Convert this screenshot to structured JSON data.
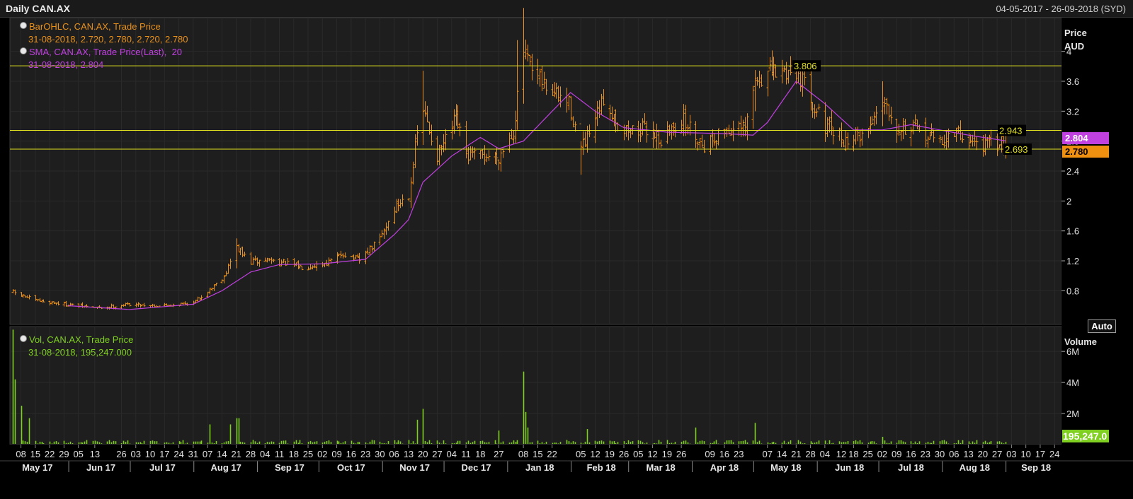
{
  "header": {
    "title": "Daily CAN.AX",
    "date_range": "04-05-2017 - 26-09-2018 (SYD)"
  },
  "legend": {
    "bar_name": "BarOHLC, CAN.AX, Trade Price",
    "bar_values": "31-08-2018, 2.720, 2.780, 2.720, 2.780",
    "sma_name": "SMA, CAN.AX, Trade Price(Last),",
    "sma_period": "20",
    "sma_values": "31-08-2018, 2.804",
    "vol_name": "Vol, CAN.AX, Trade Price",
    "vol_values": "31-08-2018, 195,247.000"
  },
  "auto_button": "Auto",
  "colors": {
    "ohlc": "#e8901c",
    "sma": "#c040e0",
    "volume": "#7fd020",
    "hline": "#e0e020",
    "grid": "#2a2a2a",
    "background": "#000000"
  },
  "chart_data": [
    {
      "type": "ohlc",
      "price_axis": {
        "label_line1": "Price",
        "label_line2": "AUD",
        "ticks": [
          0.8,
          1.2,
          1.6,
          2,
          2.4,
          2.8,
          3.2,
          3.6,
          4
        ],
        "tick_labels": [
          "0.8",
          "1.2",
          "1.6",
          "2",
          "2.4",
          "2.8",
          "3.2",
          "3.6",
          "4"
        ],
        "ylim": [
          0.35,
          4.45
        ]
      },
      "hlines": [
        {
          "value": 3.806,
          "label": "3.806"
        },
        {
          "value": 2.943,
          "label": "2.943"
        },
        {
          "value": 2.693,
          "label": "2.693"
        }
      ],
      "last_price_markers": [
        {
          "value": 2.804,
          "label": "2.804",
          "color": "#c040e0"
        },
        {
          "value": 2.78,
          "label": "2.780",
          "color": "#f09010"
        }
      ],
      "close_anchors": [
        [
          "2017-05-04",
          0.78
        ],
        [
          "2017-05-15",
          0.67
        ],
        [
          "2017-05-29",
          0.62
        ],
        [
          "2017-06-15",
          0.57
        ],
        [
          "2017-06-30",
          0.62
        ],
        [
          "2017-07-15",
          0.6
        ],
        [
          "2017-07-31",
          0.64
        ],
        [
          "2017-08-08",
          0.82
        ],
        [
          "2017-08-15",
          1.0
        ],
        [
          "2017-08-21",
          1.38
        ],
        [
          "2017-08-28",
          1.18
        ],
        [
          "2017-09-05",
          1.22
        ],
        [
          "2017-09-22",
          1.12
        ],
        [
          "2017-10-05",
          1.18
        ],
        [
          "2017-10-12",
          1.3
        ],
        [
          "2017-10-20",
          1.2
        ],
        [
          "2017-10-30",
          1.5
        ],
        [
          "2017-11-06",
          1.9
        ],
        [
          "2017-11-13",
          2.1
        ],
        [
          "2017-11-17",
          2.9
        ],
        [
          "2017-11-20",
          3.2
        ],
        [
          "2017-11-27",
          2.6
        ],
        [
          "2017-12-01",
          2.8
        ],
        [
          "2017-12-06",
          3.1
        ],
        [
          "2017-12-11",
          2.6
        ],
        [
          "2017-12-27",
          2.6
        ],
        [
          "2018-01-03",
          2.95
        ],
        [
          "2018-01-08",
          4.0
        ],
        [
          "2018-01-12",
          3.7
        ],
        [
          "2018-01-22",
          3.45
        ],
        [
          "2018-01-30",
          3.3
        ],
        [
          "2018-02-05",
          2.7
        ],
        [
          "2018-02-08",
          2.8
        ],
        [
          "2018-02-16",
          3.35
        ],
        [
          "2018-02-26",
          2.95
        ],
        [
          "2018-03-12",
          2.95
        ],
        [
          "2018-03-16",
          2.8
        ],
        [
          "2018-03-26",
          3.1
        ],
        [
          "2018-04-06",
          2.75
        ],
        [
          "2018-04-16",
          2.95
        ],
        [
          "2018-04-26",
          2.95
        ],
        [
          "2018-05-01",
          3.6
        ],
        [
          "2018-05-07",
          3.7
        ],
        [
          "2018-05-21",
          3.75
        ],
        [
          "2018-05-28",
          3.4
        ],
        [
          "2018-06-04",
          3.0
        ],
        [
          "2018-06-14",
          2.8
        ],
        [
          "2018-06-25",
          2.95
        ],
        [
          "2018-07-02",
          3.4
        ],
        [
          "2018-07-09",
          3.0
        ],
        [
          "2018-07-23",
          2.9
        ],
        [
          "2018-07-30",
          2.8
        ],
        [
          "2018-08-06",
          2.9
        ],
        [
          "2018-08-13",
          2.8
        ],
        [
          "2018-08-23",
          2.75
        ],
        [
          "2018-08-31",
          2.78
        ]
      ],
      "sma_anchors": [
        [
          "2017-05-31",
          0.6
        ],
        [
          "2017-06-30",
          0.55
        ],
        [
          "2017-07-31",
          0.62
        ],
        [
          "2017-08-14",
          0.8
        ],
        [
          "2017-08-28",
          1.05
        ],
        [
          "2017-09-11",
          1.15
        ],
        [
          "2017-10-02",
          1.16
        ],
        [
          "2017-10-23",
          1.22
        ],
        [
          "2017-11-06",
          1.55
        ],
        [
          "2017-11-13",
          1.75
        ],
        [
          "2017-11-20",
          2.25
        ],
        [
          "2017-12-04",
          2.6
        ],
        [
          "2017-12-18",
          2.85
        ],
        [
          "2017-12-27",
          2.7
        ],
        [
          "2018-01-08",
          2.8
        ],
        [
          "2018-01-22",
          3.2
        ],
        [
          "2018-01-31",
          3.45
        ],
        [
          "2018-02-12",
          3.2
        ],
        [
          "2018-02-26",
          2.98
        ],
        [
          "2018-03-19",
          2.92
        ],
        [
          "2018-04-16",
          2.9
        ],
        [
          "2018-04-30",
          2.88
        ],
        [
          "2018-05-07",
          3.05
        ],
        [
          "2018-05-21",
          3.6
        ],
        [
          "2018-06-04",
          3.3
        ],
        [
          "2018-06-18",
          2.95
        ],
        [
          "2018-07-02",
          2.95
        ],
        [
          "2018-07-16",
          3.02
        ],
        [
          "2018-07-30",
          2.95
        ],
        [
          "2018-08-13",
          2.88
        ],
        [
          "2018-08-31",
          2.804
        ]
      ],
      "spikes": [
        {
          "date": "2018-01-08",
          "high": 4.58,
          "low": 3.3
        },
        {
          "date": "2018-01-05",
          "high": 4.15,
          "low": 2.95
        },
        {
          "date": "2017-11-20",
          "high": 3.74,
          "low": 2.75
        },
        {
          "date": "2018-02-05",
          "high": 2.8,
          "low": 2.35
        },
        {
          "date": "2018-05-01",
          "high": 3.75,
          "low": 3.2
        },
        {
          "date": "2018-07-02",
          "high": 3.6,
          "low": 3.0
        },
        {
          "date": "2017-08-21",
          "high": 1.5,
          "low": 1.1
        }
      ]
    },
    {
      "type": "bar",
      "volume_axis": {
        "label": "Volume",
        "ticks": [
          2000000,
          4000000,
          6000000
        ],
        "tick_labels": [
          "2M",
          "4M",
          "6M"
        ],
        "ylim": [
          0,
          7600000
        ]
      },
      "last_volume_marker": {
        "value": 195247,
        "label": "195,247.0"
      },
      "volume_base": 150000,
      "spikes": [
        {
          "date": "2017-05-04",
          "value": 7400000
        },
        {
          "date": "2017-05-05",
          "value": 4200000
        },
        {
          "date": "2017-05-08",
          "value": 2500000
        },
        {
          "date": "2017-05-12",
          "value": 1700000
        },
        {
          "date": "2017-11-20",
          "value": 2300000
        },
        {
          "date": "2017-11-17",
          "value": 1600000
        },
        {
          "date": "2018-01-08",
          "value": 4700000
        },
        {
          "date": "2018-01-09",
          "value": 2100000
        },
        {
          "date": "2018-01-10",
          "value": 1100000
        },
        {
          "date": "2017-08-21",
          "value": 1700000
        },
        {
          "date": "2017-08-22",
          "value": 1700000
        },
        {
          "date": "2017-08-18",
          "value": 1300000
        },
        {
          "date": "2017-08-08",
          "value": 1300000
        },
        {
          "date": "2018-05-01",
          "value": 1400000
        },
        {
          "date": "2018-04-02",
          "value": 1100000
        },
        {
          "date": "2018-02-08",
          "value": 1000000
        },
        {
          "date": "2017-12-27",
          "value": 900000
        },
        {
          "date": "2018-07-02",
          "value": 500000
        }
      ]
    }
  ],
  "x_axis": {
    "day_ticks": [
      {
        "date": "2017-05-08",
        "label": "08"
      },
      {
        "date": "2017-05-15",
        "label": "15"
      },
      {
        "date": "2017-05-22",
        "label": "22"
      },
      {
        "date": "2017-05-29",
        "label": "29"
      },
      {
        "date": "2017-06-05",
        "label": "05"
      },
      {
        "date": "2017-06-13",
        "label": "13"
      },
      {
        "date": "2017-06-26",
        "label": "26"
      },
      {
        "date": "2017-07-03",
        "label": "03"
      },
      {
        "date": "2017-07-10",
        "label": "10"
      },
      {
        "date": "2017-07-17",
        "label": "17"
      },
      {
        "date": "2017-07-24",
        "label": "24"
      },
      {
        "date": "2017-07-31",
        "label": "31"
      },
      {
        "date": "2017-08-07",
        "label": "07"
      },
      {
        "date": "2017-08-14",
        "label": "14"
      },
      {
        "date": "2017-08-21",
        "label": "21"
      },
      {
        "date": "2017-08-28",
        "label": "28"
      },
      {
        "date": "2017-09-04",
        "label": "04"
      },
      {
        "date": "2017-09-11",
        "label": "11"
      },
      {
        "date": "2017-09-18",
        "label": "18"
      },
      {
        "date": "2017-09-25",
        "label": "25"
      },
      {
        "date": "2017-10-02",
        "label": "02"
      },
      {
        "date": "2017-10-09",
        "label": "09"
      },
      {
        "date": "2017-10-16",
        "label": "16"
      },
      {
        "date": "2017-10-23",
        "label": "23"
      },
      {
        "date": "2017-10-30",
        "label": "30"
      },
      {
        "date": "2017-11-06",
        "label": "06"
      },
      {
        "date": "2017-11-13",
        "label": "13"
      },
      {
        "date": "2017-11-20",
        "label": "20"
      },
      {
        "date": "2017-11-27",
        "label": "27"
      },
      {
        "date": "2017-12-04",
        "label": "04"
      },
      {
        "date": "2017-12-11",
        "label": "11"
      },
      {
        "date": "2017-12-18",
        "label": "18"
      },
      {
        "date": "2017-12-27",
        "label": "27"
      },
      {
        "date": "2018-01-08",
        "label": "08"
      },
      {
        "date": "2018-01-15",
        "label": "15"
      },
      {
        "date": "2018-01-22",
        "label": "22"
      },
      {
        "date": "2018-02-05",
        "label": "05"
      },
      {
        "date": "2018-02-12",
        "label": "12"
      },
      {
        "date": "2018-02-19",
        "label": "19"
      },
      {
        "date": "2018-02-26",
        "label": "26"
      },
      {
        "date": "2018-03-05",
        "label": "05"
      },
      {
        "date": "2018-03-12",
        "label": "12"
      },
      {
        "date": "2018-03-19",
        "label": "19"
      },
      {
        "date": "2018-03-26",
        "label": "26"
      },
      {
        "date": "2018-04-09",
        "label": "09"
      },
      {
        "date": "2018-04-16",
        "label": "16"
      },
      {
        "date": "2018-04-23",
        "label": "23"
      },
      {
        "date": "2018-05-07",
        "label": "07"
      },
      {
        "date": "2018-05-14",
        "label": "14"
      },
      {
        "date": "2018-05-21",
        "label": "21"
      },
      {
        "date": "2018-05-28",
        "label": "28"
      },
      {
        "date": "2018-06-04",
        "label": "04"
      },
      {
        "date": "2018-06-12",
        "label": "12"
      },
      {
        "date": "2018-06-18",
        "label": "18"
      },
      {
        "date": "2018-06-25",
        "label": "25"
      },
      {
        "date": "2018-07-02",
        "label": "02"
      },
      {
        "date": "2018-07-09",
        "label": "09"
      },
      {
        "date": "2018-07-16",
        "label": "16"
      },
      {
        "date": "2018-07-23",
        "label": "23"
      },
      {
        "date": "2018-07-30",
        "label": "30"
      },
      {
        "date": "2018-08-06",
        "label": "06"
      },
      {
        "date": "2018-08-13",
        "label": "13"
      },
      {
        "date": "2018-08-20",
        "label": "20"
      },
      {
        "date": "2018-08-27",
        "label": "27"
      },
      {
        "date": "2018-09-03",
        "label": "03"
      },
      {
        "date": "2018-09-10",
        "label": "10"
      },
      {
        "date": "2018-09-17",
        "label": "17"
      },
      {
        "date": "2018-09-24",
        "label": "24"
      }
    ],
    "month_ticks": [
      {
        "date": "2017-05-16",
        "label": "May 17"
      },
      {
        "date": "2017-06-16",
        "label": "Jun 17"
      },
      {
        "date": "2017-07-16",
        "label": "Jul 17"
      },
      {
        "date": "2017-08-16",
        "label": "Aug 17"
      },
      {
        "date": "2017-09-16",
        "label": "Sep 17"
      },
      {
        "date": "2017-10-16",
        "label": "Oct 17"
      },
      {
        "date": "2017-11-16",
        "label": "Nov 17"
      },
      {
        "date": "2017-12-16",
        "label": "Dec 17"
      },
      {
        "date": "2018-01-16",
        "label": "Jan 18"
      },
      {
        "date": "2018-02-15",
        "label": "Feb 18"
      },
      {
        "date": "2018-03-16",
        "label": "Mar 18"
      },
      {
        "date": "2018-04-16",
        "label": "Apr 18"
      },
      {
        "date": "2018-05-16",
        "label": "May 18"
      },
      {
        "date": "2018-06-16",
        "label": "Jun 18"
      },
      {
        "date": "2018-07-16",
        "label": "Jul 18"
      },
      {
        "date": "2018-08-16",
        "label": "Aug 18"
      },
      {
        "date": "2018-09-15",
        "label": "Sep 18"
      }
    ],
    "month_separators": [
      "2017-06-01",
      "2017-07-01",
      "2017-08-01",
      "2017-09-01",
      "2017-10-01",
      "2017-11-01",
      "2017-12-01",
      "2018-01-01",
      "2018-02-01",
      "2018-03-01",
      "2018-04-01",
      "2018-05-01",
      "2018-06-01",
      "2018-07-01",
      "2018-08-01",
      "2018-09-01"
    ],
    "start_date": "2017-05-04",
    "end_date": "2018-09-26",
    "last_data_date": "2018-08-31"
  }
}
